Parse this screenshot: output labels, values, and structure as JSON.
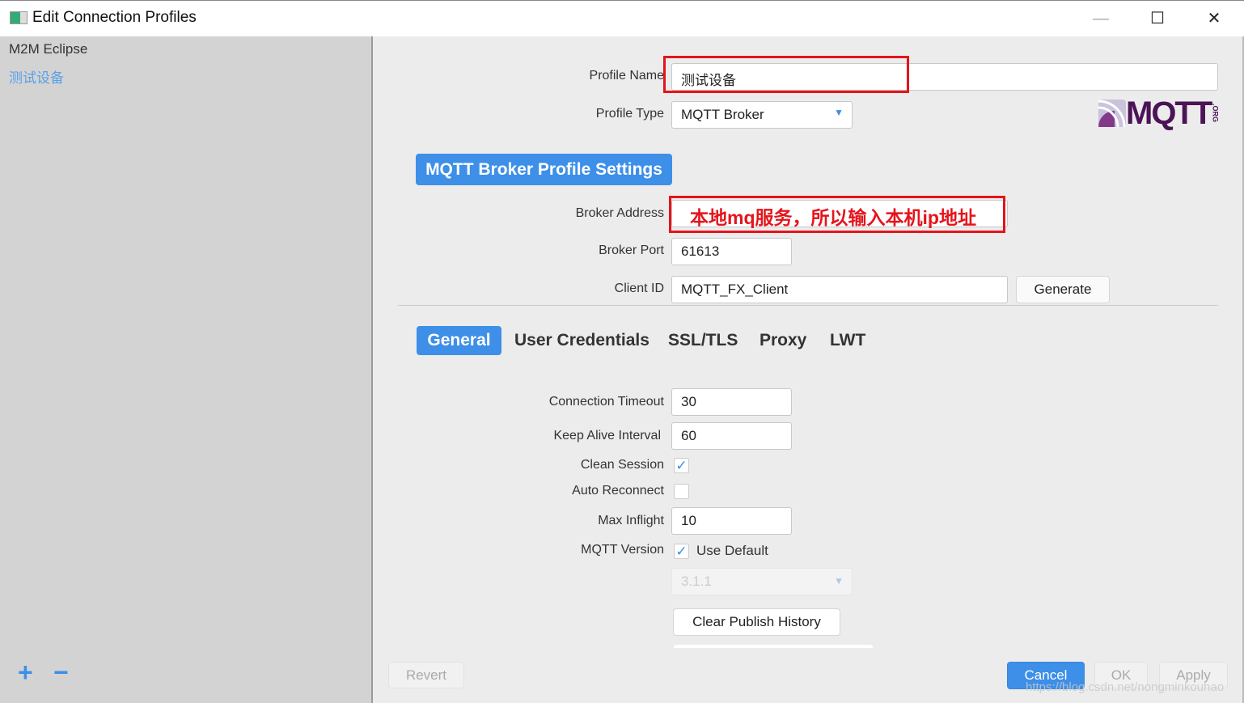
{
  "window": {
    "title": "Edit Connection Profiles"
  },
  "sidebar": {
    "items": [
      {
        "label": "M2M Eclipse"
      },
      {
        "label": "测试设备"
      }
    ],
    "add": "+",
    "remove": "−"
  },
  "form": {
    "profile_name_label": "Profile Name",
    "profile_name": "测试设备",
    "profile_type_label": "Profile Type",
    "profile_type": "MQTT Broker",
    "logo": "MQTT.ORG",
    "section_title": "MQTT Broker Profile Settings",
    "broker_address_label": "Broker Address",
    "broker_address_note": "本地mq服务，所以输入本机ip地址",
    "broker_port_label": "Broker Port",
    "broker_port": "61613",
    "client_id_label": "Client ID",
    "client_id": "MQTT_FX_Client",
    "generate": "Generate"
  },
  "tabs": [
    {
      "label": "General",
      "active": true
    },
    {
      "label": "User Credentials"
    },
    {
      "label": "SSL/TLS"
    },
    {
      "label": "Proxy"
    },
    {
      "label": "LWT"
    }
  ],
  "general": {
    "timeout_label": "Connection Timeout",
    "timeout": "30",
    "keepalive_label": "Keep Alive Interval",
    "keepalive": "60",
    "clean_session_label": "Clean Session",
    "clean_session": true,
    "auto_reconnect_label": "Auto Reconnect",
    "auto_reconnect": false,
    "max_inflight_label": "Max Inflight",
    "max_inflight": "10",
    "mqtt_version_label": "MQTT Version",
    "use_default": true,
    "use_default_label": "Use Default",
    "version": "3.1.1",
    "clear_history": "Clear Publish History"
  },
  "footer": {
    "revert": "Revert",
    "cancel": "Cancel",
    "ok": "OK",
    "apply": "Apply",
    "watermark": "https://blog.csdn.net/nongminkouhao"
  },
  "colors": {
    "accent": "#3d8fe8",
    "annotation": "#e5141b",
    "link": "#5aa0e8"
  }
}
